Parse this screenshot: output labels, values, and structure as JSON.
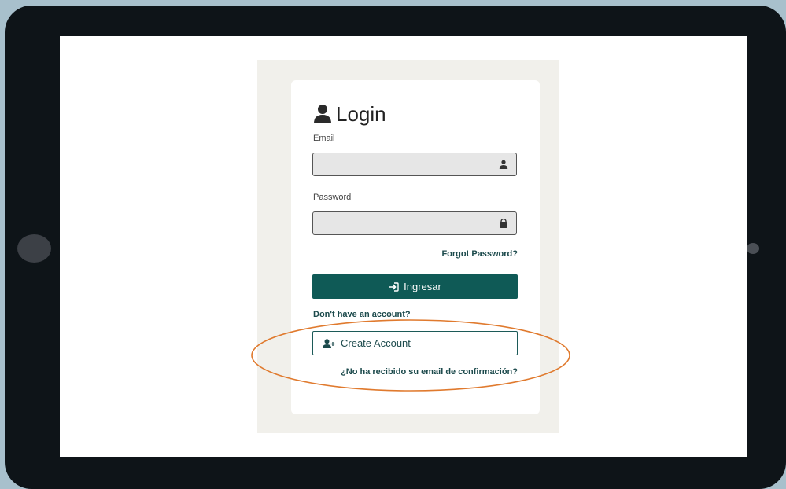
{
  "login": {
    "title": "Login",
    "email_label": "Email",
    "email_value": "",
    "password_label": "Password",
    "password_value": "",
    "forgot_password": "Forgot Password?",
    "submit_label": "Ingresar",
    "no_account_text": "Don't have an account?",
    "create_account_label": "Create Account",
    "resend_confirmation": "¿No ha recibido su email de confirmación?"
  },
  "icons": {
    "title": "user-icon",
    "email": "user-icon",
    "password": "lock-icon",
    "submit": "sign-in-icon",
    "create_account": "user-plus-icon"
  },
  "colors": {
    "primary": "#0f5a56",
    "link": "#1c4a4c",
    "annotation": "#e07a2e",
    "page_background": "#f1f0eb"
  }
}
